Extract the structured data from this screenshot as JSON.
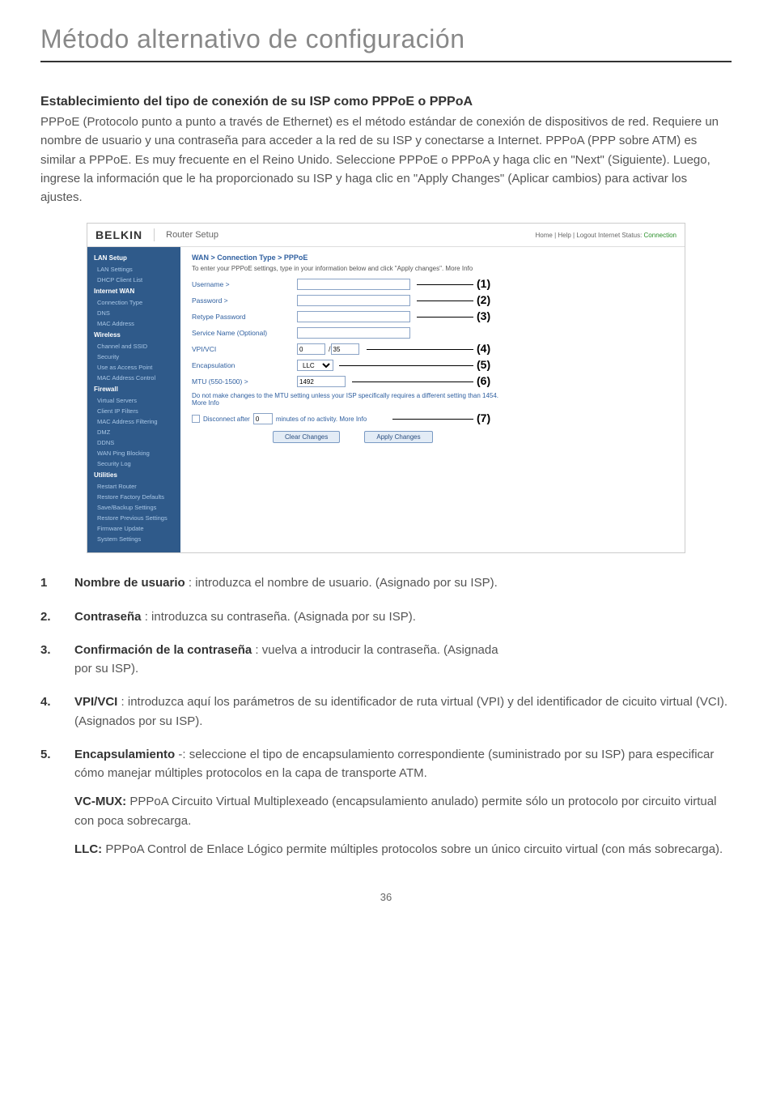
{
  "page_title": "Método alternativo de configuración",
  "heading": "Establecimiento del tipo de conexión de su ISP como PPPoE o PPPoA",
  "intro": "PPPoE (Protocolo punto a punto a través de Ethernet) es el método estándar de conexión de dispositivos de red. Requiere un nombre de usuario y una contraseña para acceder a la red de su ISP y conectarse a Internet. PPPoA (PPP sobre ATM) es similar a PPPoE. Es muy frecuente en el Reino Unido. Seleccione PPPoE o PPPoA y haga clic en \"Next\" (Siguiente). Luego, ingrese la información que le ha proporcionado su ISP y haga clic en \"Apply Changes\" (Aplicar cambios) para activar los ajustes.",
  "screenshot": {
    "brand": "BELKIN",
    "router_setup": "Router Setup",
    "top_links": "Home | Help | Logout   Internet Status: ",
    "status_word": "Connection",
    "sidebar": {
      "lan_setup": "LAN Setup",
      "lan_items": [
        "LAN Settings",
        "DHCP Client List"
      ],
      "internet_wan": "Internet WAN",
      "wan_items": [
        "Connection Type",
        "DNS",
        "MAC Address"
      ],
      "wireless": "Wireless",
      "wireless_items": [
        "Channel and SSID",
        "Security",
        "Use as Access Point",
        "MAC Address Control"
      ],
      "firewall": "Firewall",
      "firewall_items": [
        "Virtual Servers",
        "Client IP Filters",
        "MAC Address Filtering",
        "DMZ",
        "DDNS",
        "WAN Ping Blocking",
        "Security Log"
      ],
      "utilities": "Utilities",
      "utilities_items": [
        "Restart Router",
        "Restore Factory Defaults",
        "Save/Backup Settings",
        "Restore Previous Settings",
        "Firmware Update",
        "System Settings"
      ]
    },
    "breadcrumb": "WAN > Connection Type > PPPoE",
    "subtext": "To enter your PPPoE settings, type in your information below and click \"Apply changes\". More Info",
    "labels": {
      "username": "Username >",
      "password": "Password >",
      "retype": "Retype Password",
      "service": "Service Name (Optional)",
      "vpivci": "VPI/VCI",
      "encaps": "Encapsulation",
      "mtu": "MTU (550-1500) >"
    },
    "vpi_a": "0",
    "vpi_b": "35",
    "encaps_val": "LLC",
    "mtu_val": "1492",
    "note": "Do not make changes to the MTU setting unless your ISP specifically requires a different setting than 1454. More Info",
    "disconnect_label": "Disconnect after",
    "disconnect_tail": "minutes of no activity. More Info",
    "disconnect_val": "0",
    "clear": "Clear Changes",
    "apply": "Apply Changes",
    "callouts": [
      "(1)",
      "(2)",
      "(3)",
      "(4)",
      "(5)",
      "(6)",
      "(7)"
    ]
  },
  "items": [
    {
      "num": "1",
      "lead": "Nombre de usuario",
      "text": " : introduzca el nombre de usuario. (Asignado por su ISP)."
    },
    {
      "num": "2.",
      "lead": "Contraseña",
      "text": " : introduzca su contraseña. (Asignada por su ISP)."
    },
    {
      "num": "3.",
      "lead": "Confirmación de la contraseña",
      "text": " : vuelva a introducir la contraseña. (Asignada",
      "text2": " por su ISP)."
    },
    {
      "num": "4.",
      "lead": "VPI/VCI",
      "text": " : introduzca aquí los parámetros de su identificador de ruta virtual (VPI) y del identificador de cicuito virtual (VCI). (Asignados por su ISP)."
    },
    {
      "num": "5.",
      "lead": "Encapsulamiento",
      "text": " -: seleccione el tipo de encapsulamiento correspondiente (suministrado por su ISP) para especificar cómo manejar múltiples protocolos en la capa de transporte ATM.",
      "sub1_lead": "VC-MUX:",
      "sub1": " PPPoA Circuito Virtual Multiplexeado (encapsulamiento anulado) permite sólo un protocolo por circuito virtual con poca sobrecarga.",
      "sub2_lead": "LLC:",
      "sub2": " PPPoA Control de Enlace Lógico permite múltiples protocolos sobre un único circuito virtual (con más sobrecarga)."
    }
  ],
  "page_number": "36"
}
